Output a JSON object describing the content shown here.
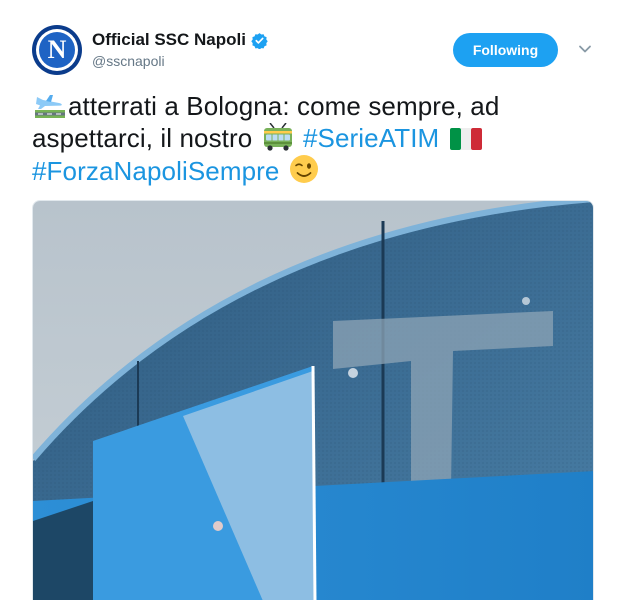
{
  "tweet": {
    "display_name": "Official SSC Napoli",
    "handle": "@sscnapoli",
    "avatar_letter": "N",
    "follow_label": "Following",
    "text_part1": "atterrati a Bologna: come sempre, ad",
    "text_part2": "aspettarci, il nostro",
    "hashtag1": "#SerieATIM",
    "hashtag2": "#ForzaNapoliSempre",
    "icons": {
      "verified": "verified-badge-icon",
      "caret": "chevron-down-icon",
      "emoji1": "airplane-arriving-emoji",
      "emoji2": "trolleybus-emoji",
      "emoji3": "italy-flag-emoji",
      "emoji4": "winking-face-emoji"
    },
    "colors": {
      "accent": "#1da1f2",
      "hashtag": "#1b95e0",
      "text": "#14171a",
      "muted": "#657786"
    }
  }
}
